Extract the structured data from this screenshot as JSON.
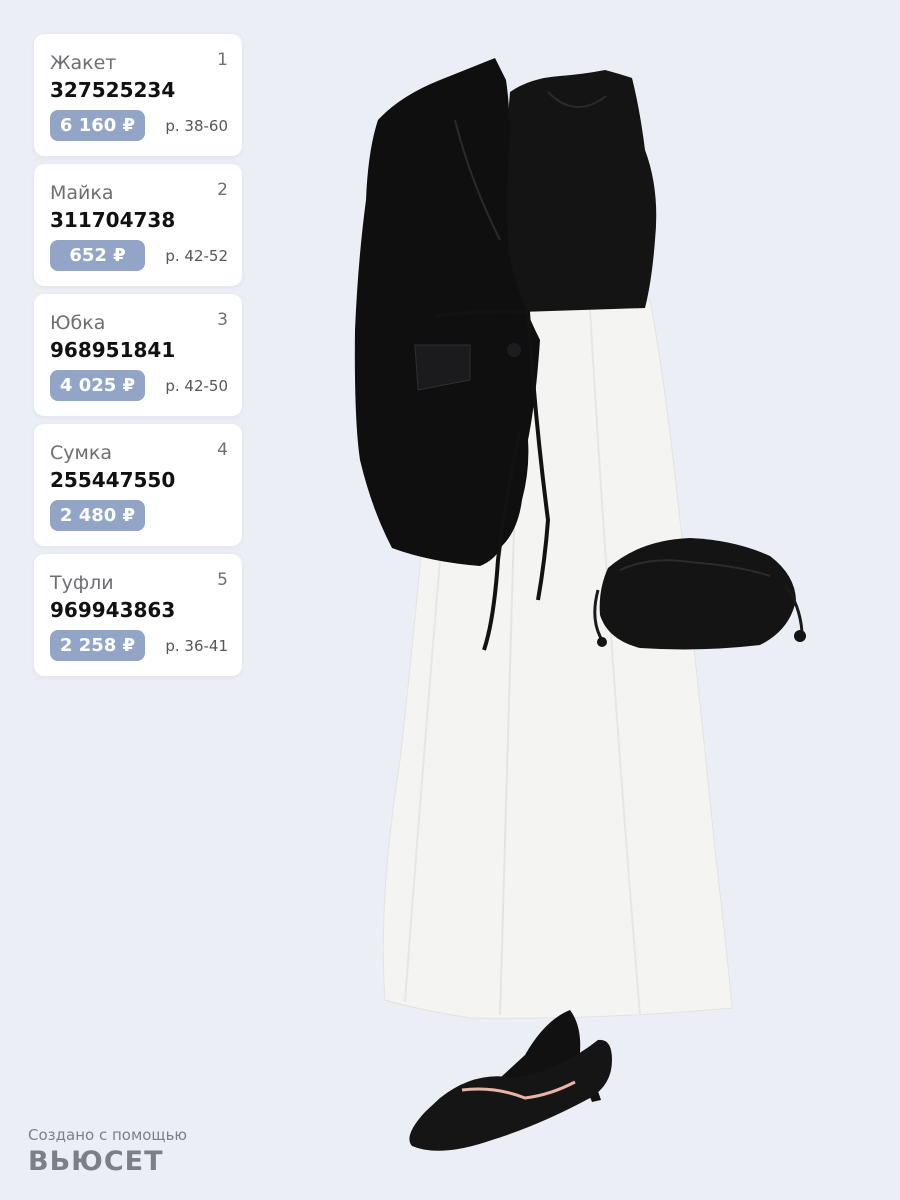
{
  "items": [
    {
      "category": "Жакет",
      "number": "1",
      "article": "327525234",
      "price": "6 160 ₽",
      "size": "р. 38-60"
    },
    {
      "category": "Майка",
      "number": "2",
      "article": "311704738",
      "price": "652 ₽",
      "size": "р. 42-52"
    },
    {
      "category": "Юбка",
      "number": "3",
      "article": "968951841",
      "price": "4 025 ₽",
      "size": "р. 42-50"
    },
    {
      "category": "Сумка",
      "number": "4",
      "article": "255447550",
      "price": "2 480 ₽",
      "size": ""
    },
    {
      "category": "Туфли",
      "number": "5",
      "article": "969943863",
      "price": "2 258 ₽",
      "size": "р. 36-41"
    }
  ],
  "footer": {
    "caption": "Создано с помощью",
    "logo": "ВЬЮСЕТ"
  }
}
